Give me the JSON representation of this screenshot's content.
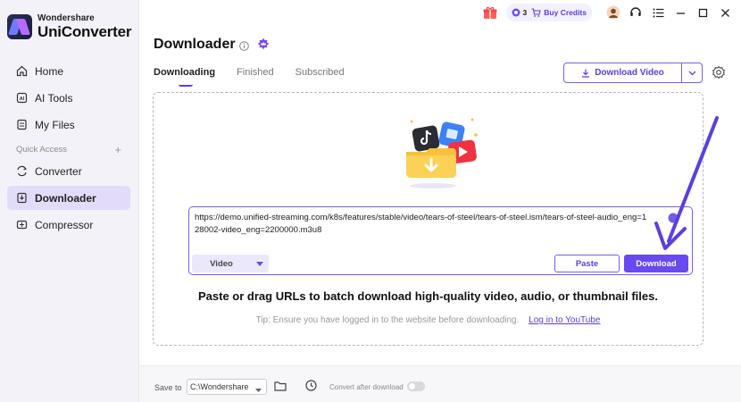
{
  "app": {
    "brand_sub": "Wondershare",
    "brand_main": "UniConverter"
  },
  "sidebar": {
    "items": [
      {
        "label": "Home",
        "icon": "home-icon"
      },
      {
        "label": "AI Tools",
        "icon": "ai-tools-icon"
      },
      {
        "label": "My Files",
        "icon": "my-files-icon"
      }
    ],
    "quick_access_label": "Quick Access",
    "quick_items": [
      {
        "label": "Converter",
        "icon": "converter-icon"
      },
      {
        "label": "Downloader",
        "icon": "downloader-icon",
        "active": true
      },
      {
        "label": "Compressor",
        "icon": "compressor-icon"
      }
    ]
  },
  "topbar": {
    "credits_count": "3",
    "buy_credits_label": "Buy Credits"
  },
  "page": {
    "title": "Downloader",
    "tabs": [
      {
        "label": "Downloading",
        "active": true
      },
      {
        "label": "Finished"
      },
      {
        "label": "Subscribed"
      }
    ],
    "download_video_label": "Download Video"
  },
  "url_box": {
    "value": "https://demo.unified-streaming.com/k8s/features/stable/video/tears-of-steel/tears-of-steel.ism/tears-of-steel-audio_eng=128002-video_eng=2200000.m3u8",
    "format_label": "Video",
    "paste_label": "Paste",
    "download_label": "Download"
  },
  "headline": "Paste or drag URLs to batch download high-quality video, audio, or thumbnail files.",
  "tip": {
    "text": "Tip: Ensure you have logged in to the website before downloading.",
    "link": "Log in to YouTube"
  },
  "footer": {
    "save_to_label": "Save to",
    "save_path": "C:\\Wondershare",
    "convert_after_label": "Convert after download",
    "convert_after_enabled": false
  },
  "colors": {
    "accent": "#6a4af0",
    "sidebar_bg": "#f3f2f8",
    "active_nav_bg": "#e2dcfa"
  }
}
